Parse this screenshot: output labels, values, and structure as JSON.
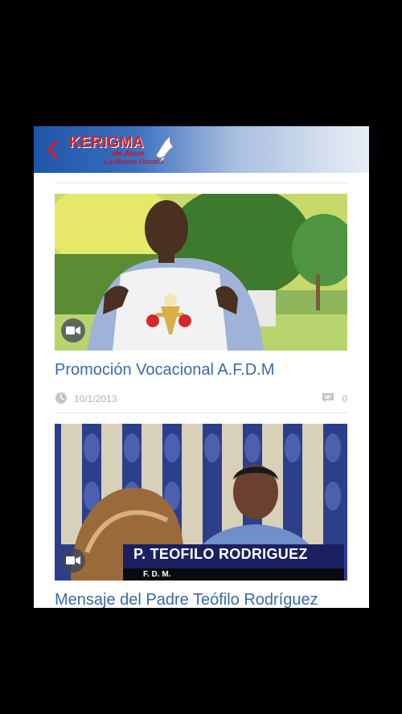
{
  "app": {
    "logo_title": "KERIGMA",
    "logo_line1": "de Amor",
    "logo_line2": "La Nueva Unción"
  },
  "posts": [
    {
      "title": "Promoción Vocacional A.F.D.M",
      "date": "10/1/2013",
      "comments": "0",
      "media": "video-icon"
    },
    {
      "title": "Mensaje del Padre Teófilo Rodríguez",
      "caption_name": "P. TEOFILO RODRIGUEZ",
      "caption_sub": "F. D. M.",
      "media": "video-icon"
    }
  ],
  "colors": {
    "header_blue": "#1e56a8",
    "title_blue": "#3a6aaa",
    "logo_red": "#d81f26"
  }
}
